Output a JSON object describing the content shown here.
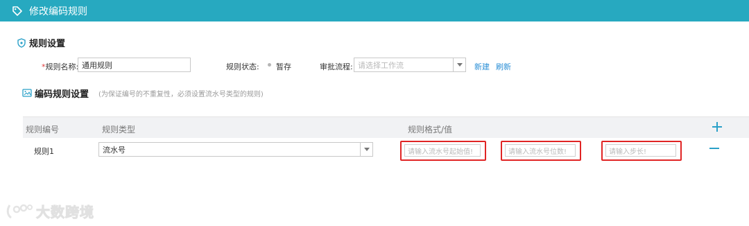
{
  "header": {
    "title": "修改编码规则",
    "icon": "tag-icon"
  },
  "rule_settings": {
    "title": "规则设置",
    "icon": "shield-icon",
    "name_required_mark": "*",
    "name_label": "规则名称:",
    "name_value": "通用规则",
    "status_label": "规则状态:",
    "status_value": "暂存",
    "workflow_label": "审批流程:",
    "workflow_placeholder": "请选择工作流",
    "new_link": "新建",
    "refresh_link": "刷新"
  },
  "code_rule_settings": {
    "title": "编码规则设置",
    "hint": "(为保证编号的不重复性，必须设置流水号类型的规则)",
    "icon": "image-settings-icon"
  },
  "table": {
    "columns": [
      "规则编号",
      "规则类型",
      "规则格式/值"
    ],
    "rows": [
      {
        "rule_no": "规则1",
        "rule_type": "流水号",
        "start_placeholder": "请输入流水号起始值!",
        "digits_placeholder": "请输入流水号位数!",
        "step_placeholder": "请输入步长!"
      }
    ]
  },
  "colors": {
    "header_bg": "#27a9c0",
    "accent": "#2aa0c8",
    "highlight": "#e02424",
    "link": "#2b8fd6"
  },
  "watermark": {
    "text": "大数跨境"
  }
}
